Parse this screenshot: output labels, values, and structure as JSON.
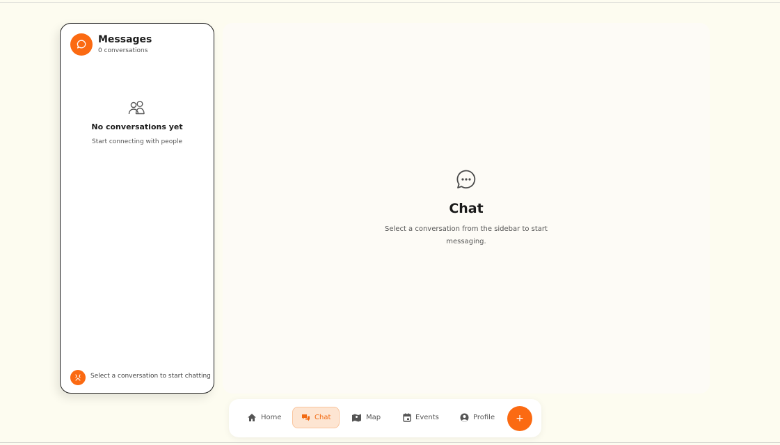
{
  "sidebar": {
    "title": "Messages",
    "count": "0 conversations",
    "empty_title": "No conversations yet",
    "empty_subtitle": "Start connecting with people",
    "footer_text": "Select a conversation to start chatting"
  },
  "main": {
    "title": "Chat",
    "subtitle_line1": "Select a conversation from the sidebar to start",
    "subtitle_line2": "messaging."
  },
  "nav": {
    "items": [
      {
        "label": "Home",
        "icon": "home-icon"
      },
      {
        "label": "Chat",
        "icon": "chat-icon",
        "active": true
      },
      {
        "label": "Map",
        "icon": "map-icon"
      },
      {
        "label": "Events",
        "icon": "calendar-icon"
      },
      {
        "label": "Profile",
        "icon": "user-circle-icon"
      }
    ],
    "fab_label": "+"
  },
  "colors": {
    "accent": "#fb6a12",
    "background": "#fdfcf0",
    "active_nav_bg": "#fde5d2"
  }
}
